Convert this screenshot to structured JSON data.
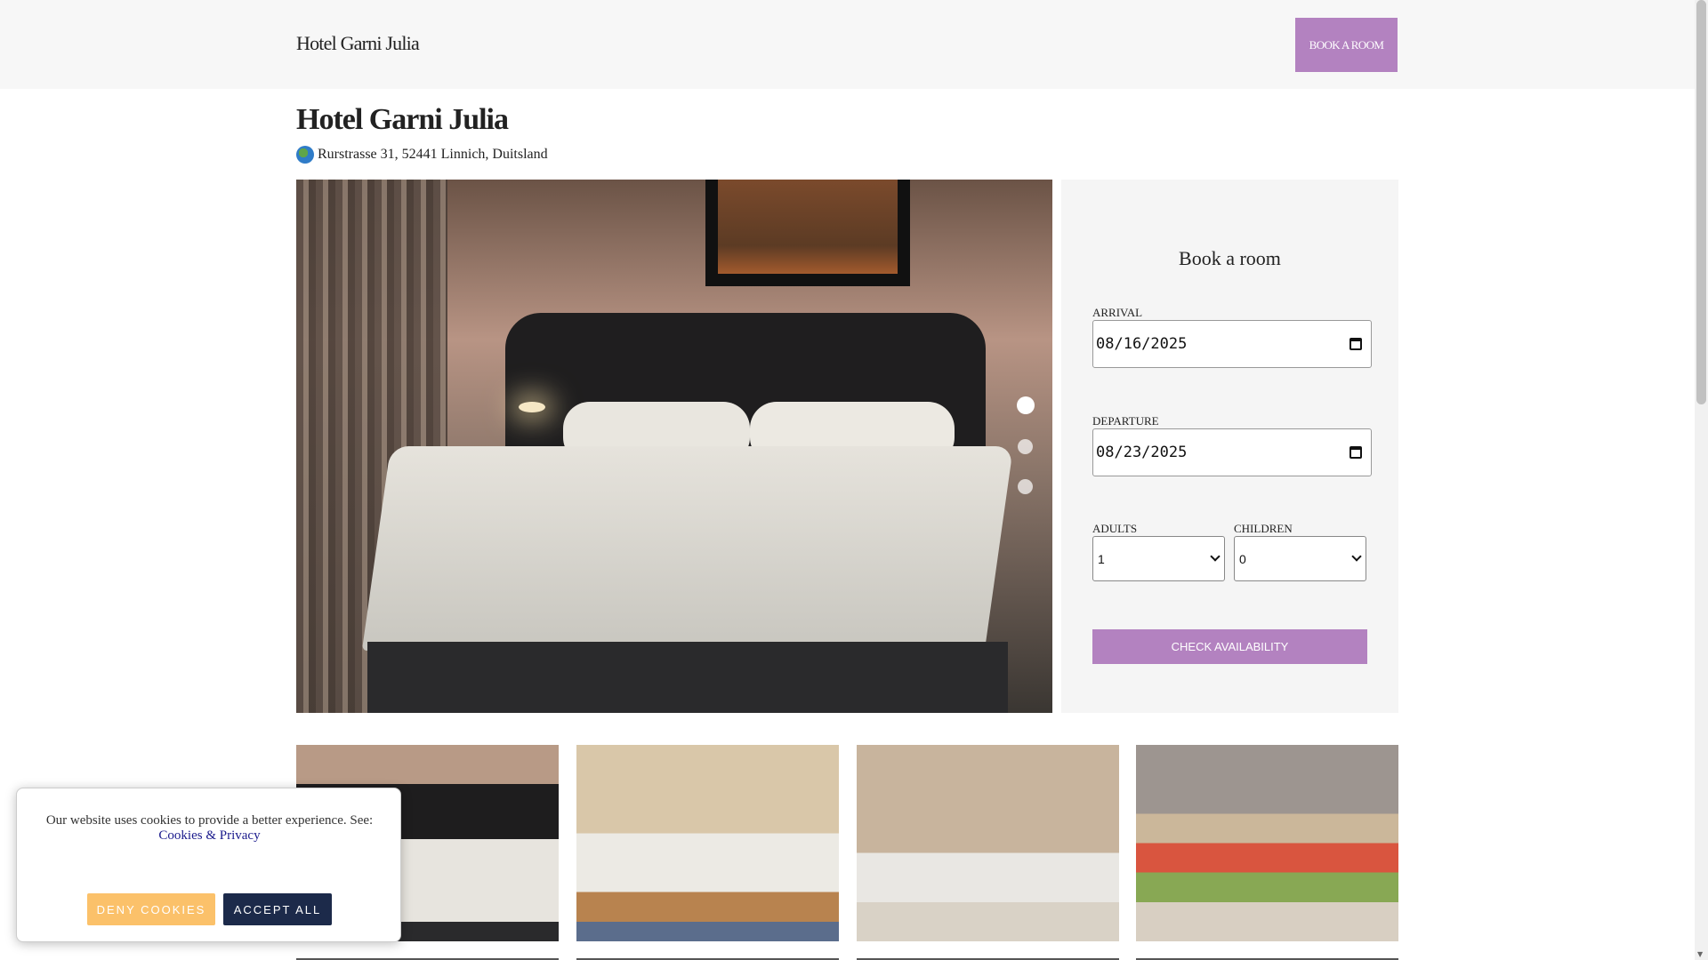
{
  "header": {
    "brand": "Hotel Garni Julia",
    "book_button": "BOOK A ROOM"
  },
  "hotel": {
    "name": "Hotel Garni Julia",
    "address": "Rurstrasse 31, 52441 Linnich, Duitsland"
  },
  "gallery": {
    "active_slide": 1,
    "slide_count": 3,
    "thumbnail_count": 4
  },
  "booking": {
    "title": "Book a room",
    "arrival_label": "ARRIVAL",
    "arrival_value": "08/16/2025",
    "departure_label": "DEPARTURE",
    "departure_value": "08/23/2025",
    "adults_label": "ADULTS",
    "adults_value": "1",
    "children_label": "CHILDREN",
    "children_value": "0",
    "check_button": "CHECK AVAILABILITY"
  },
  "cookie_banner": {
    "message": "Our website uses cookies to provide a better experience. See:",
    "link": "Cookies & Privacy",
    "deny_button": "DENY COOKIES",
    "accept_button": "ACCEPT ALL"
  },
  "colors": {
    "accent": "#b382c0",
    "deny": "#fbc16a",
    "accept": "#1c2a4a"
  }
}
